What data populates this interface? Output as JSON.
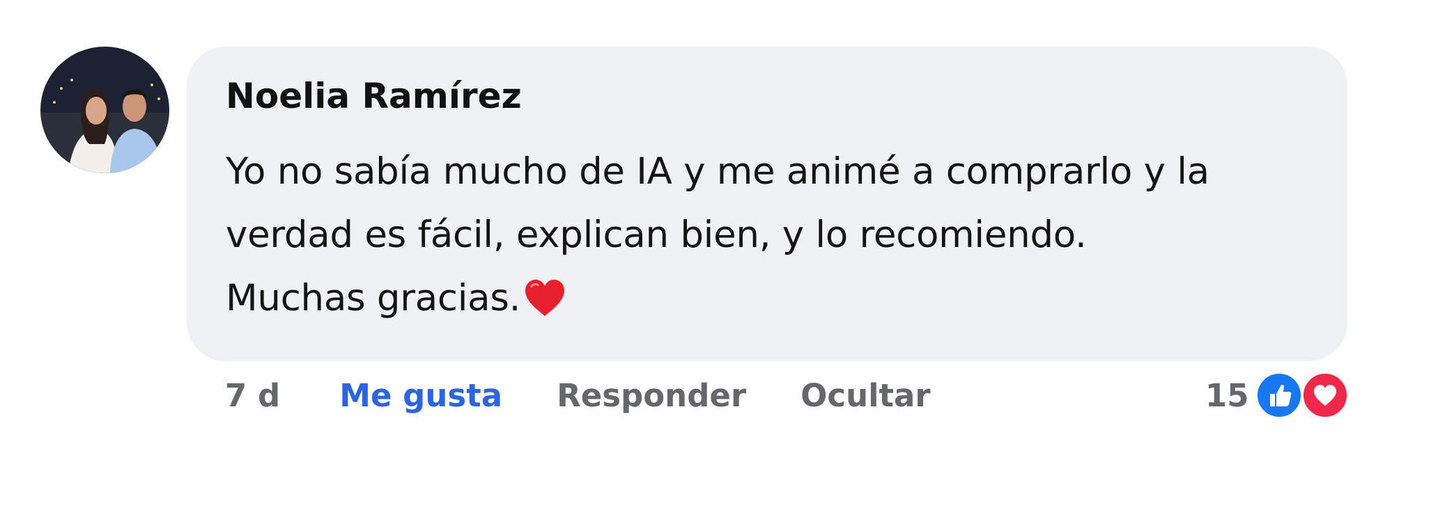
{
  "comment": {
    "author": "Noelia Ramírez",
    "lines": [
      "Yo no sabía mucho de IA y me animé a comprarlo y la",
      "verdad es fácil, explican bien, y lo recomiendo.",
      "Muchas gracias."
    ],
    "emoji": "heart-emoji"
  },
  "actions": {
    "time": "7 d",
    "like_label": "Me gusta",
    "reply_label": "Responder",
    "hide_label": "Ocultar"
  },
  "reactions": {
    "count": "15",
    "icons": [
      "like-icon",
      "love-icon"
    ]
  },
  "colors": {
    "bubble": "#f0f1f5",
    "like_text": "#2d64e0",
    "secondary_text": "#65676b",
    "like_reaction": "#1877f2",
    "love_reaction": "#f0284a"
  }
}
